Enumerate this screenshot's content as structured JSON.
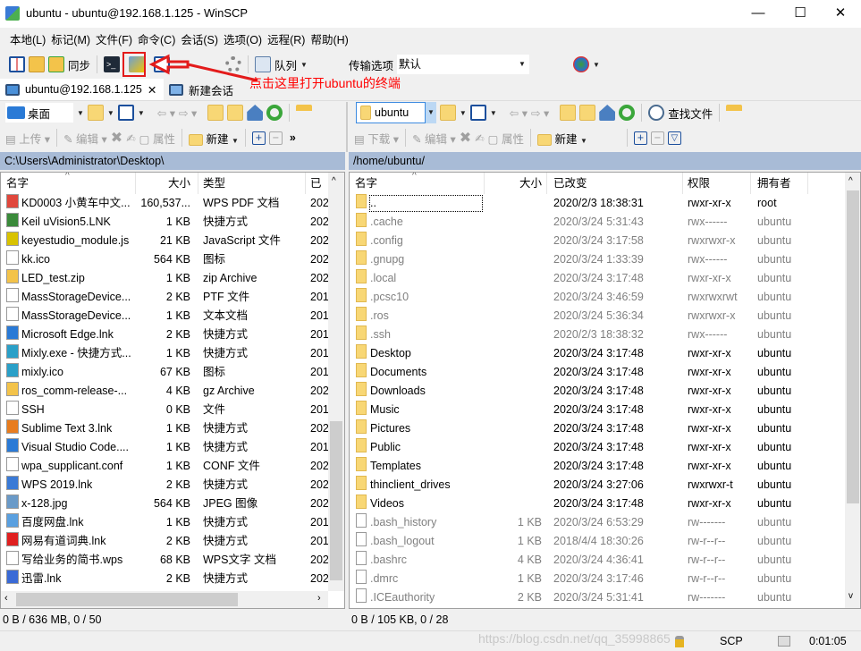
{
  "window": {
    "title": "ubuntu - ubuntu@192.168.1.125 - WinSCP",
    "minimize": "—",
    "maximize": "☐",
    "close": "✕"
  },
  "menu": [
    "本地(L)",
    "标记(M)",
    "文件(F)",
    "命令(C)",
    "会话(S)",
    "选项(O)",
    "远程(R)",
    "帮助(H)"
  ],
  "toolbar": {
    "sync": "同步",
    "queue": "队列",
    "transfer_label": "传输选项",
    "transfer_value": "默认"
  },
  "annotation": {
    "text": "点击这里打开ubuntu的终端",
    "color": "#ff0000"
  },
  "tabs": [
    {
      "label": "ubuntu@192.168.1.125",
      "close": "✕"
    },
    {
      "label": "新建会话"
    }
  ],
  "local": {
    "drive": "桌面",
    "path": "C:\\Users\\Administrator\\Desktop\\",
    "actions": {
      "upload": "上传",
      "edit": "编辑",
      "properties": "属性",
      "new": "新建",
      "more": "»"
    },
    "columns": [
      "名字",
      "大小",
      "类型",
      "已改"
    ],
    "files": [
      [
        "KD0003  小黄车中文...",
        "160,537...",
        "WPS PDF 文档",
        "202"
      ],
      [
        "Keil uVision5.LNK",
        "1 KB",
        "快捷方式",
        "202"
      ],
      [
        "keyestudio_module.js",
        "21 KB",
        "JavaScript 文件",
        "202"
      ],
      [
        "kk.ico",
        "564 KB",
        "图标",
        "202"
      ],
      [
        "LED_test.zip",
        "1 KB",
        "zip Archive",
        "202"
      ],
      [
        "MassStorageDevice...",
        "2 KB",
        "PTF 文件",
        "201"
      ],
      [
        "MassStorageDevice...",
        "1 KB",
        "文本文档",
        "201"
      ],
      [
        "Microsoft Edge.lnk",
        "2 KB",
        "快捷方式",
        "201"
      ],
      [
        "Mixly.exe - 快捷方式...",
        "1 KB",
        "快捷方式",
        "201"
      ],
      [
        "mixly.ico",
        "67 KB",
        "图标",
        "201"
      ],
      [
        "ros_comm-release-...",
        "4 KB",
        "gz Archive",
        "202"
      ],
      [
        "SSH",
        "0 KB",
        "文件",
        "201"
      ],
      [
        "Sublime Text 3.lnk",
        "1 KB",
        "快捷方式",
        "202"
      ],
      [
        "Visual Studio Code....",
        "1 KB",
        "快捷方式",
        "201"
      ],
      [
        "wpa_supplicant.conf",
        "1 KB",
        "CONF 文件",
        "202"
      ],
      [
        "WPS 2019.lnk",
        "2 KB",
        "快捷方式",
        "202"
      ],
      [
        "x-128.jpg",
        "564 KB",
        "JPEG 图像",
        "202"
      ],
      [
        "百度网盘.lnk",
        "1 KB",
        "快捷方式",
        "201"
      ],
      [
        "网易有道词典.lnk",
        "2 KB",
        "快捷方式",
        "201"
      ],
      [
        "写给业务的简书.wps",
        "68 KB",
        "WPS文字 文档",
        "202"
      ],
      [
        "迅雷.lnk",
        "2 KB",
        "快捷方式",
        "202"
      ]
    ],
    "status": "0 B / 636 MB,  0 / 50"
  },
  "remote": {
    "dir": "ubuntu",
    "path": "/home/ubuntu/",
    "find": "查找文件",
    "actions": {
      "download": "下载",
      "edit": "编辑",
      "properties": "属性",
      "new": "新建"
    },
    "columns": [
      "名字",
      "大小",
      "已改变",
      "权限",
      "拥有者"
    ],
    "files": [
      [
        "..",
        "",
        "2020/2/3 18:38:31",
        "rwxr-xr-x",
        "root",
        "up",
        false
      ],
      [
        ".cache",
        "",
        "2020/3/24 5:31:43",
        "rwx------",
        "ubuntu",
        "folder",
        true
      ],
      [
        ".config",
        "",
        "2020/3/24 3:17:58",
        "rwxrwxr-x",
        "ubuntu",
        "folder",
        true
      ],
      [
        ".gnupg",
        "",
        "2020/3/24 1:33:39",
        "rwx------",
        "ubuntu",
        "folder",
        true
      ],
      [
        ".local",
        "",
        "2020/3/24 3:17:48",
        "rwxr-xr-x",
        "ubuntu",
        "folder",
        true
      ],
      [
        ".pcsc10",
        "",
        "2020/3/24 3:46:59",
        "rwxrwxrwt",
        "ubuntu",
        "folder",
        true
      ],
      [
        ".ros",
        "",
        "2020/3/24 5:36:34",
        "rwxrwxr-x",
        "ubuntu",
        "folder",
        true
      ],
      [
        ".ssh",
        "",
        "2020/2/3 18:38:32",
        "rwx------",
        "ubuntu",
        "folder",
        true
      ],
      [
        "Desktop",
        "",
        "2020/3/24 3:17:48",
        "rwxr-xr-x",
        "ubuntu",
        "folder",
        false
      ],
      [
        "Documents",
        "",
        "2020/3/24 3:17:48",
        "rwxr-xr-x",
        "ubuntu",
        "folder",
        false
      ],
      [
        "Downloads",
        "",
        "2020/3/24 3:17:48",
        "rwxr-xr-x",
        "ubuntu",
        "folder",
        false
      ],
      [
        "Music",
        "",
        "2020/3/24 3:17:48",
        "rwxr-xr-x",
        "ubuntu",
        "folder",
        false
      ],
      [
        "Pictures",
        "",
        "2020/3/24 3:17:48",
        "rwxr-xr-x",
        "ubuntu",
        "folder",
        false
      ],
      [
        "Public",
        "",
        "2020/3/24 3:17:48",
        "rwxr-xr-x",
        "ubuntu",
        "folder",
        false
      ],
      [
        "Templates",
        "",
        "2020/3/24 3:17:48",
        "rwxr-xr-x",
        "ubuntu",
        "folder",
        false
      ],
      [
        "thinclient_drives",
        "",
        "2020/3/24 3:27:06",
        "rwxrwxr-t",
        "ubuntu",
        "folder",
        false
      ],
      [
        "Videos",
        "",
        "2020/3/24 3:17:48",
        "rwxr-xr-x",
        "ubuntu",
        "folder",
        false
      ],
      [
        ".bash_history",
        "1 KB",
        "2020/3/24 6:53:29",
        "rw-------",
        "ubuntu",
        "file",
        true
      ],
      [
        ".bash_logout",
        "1 KB",
        "2018/4/4 18:30:26",
        "rw-r--r--",
        "ubuntu",
        "file",
        true
      ],
      [
        ".bashrc",
        "4 KB",
        "2020/3/24 4:36:41",
        "rw-r--r--",
        "ubuntu",
        "file",
        true
      ],
      [
        ".dmrc",
        "1 KB",
        "2020/3/24 3:17:46",
        "rw-r--r--",
        "ubuntu",
        "file",
        true
      ],
      [
        ".ICEauthority",
        "2 KB",
        "2020/3/24 5:31:41",
        "rw-------",
        "ubuntu",
        "file",
        true
      ]
    ],
    "status": "0 B / 105 KB,  0 / 28"
  },
  "footer": {
    "protocol": "SCP",
    "elapsed": "0:01:05",
    "watermark": "https://blog.csdn.net/qq_35998865"
  }
}
